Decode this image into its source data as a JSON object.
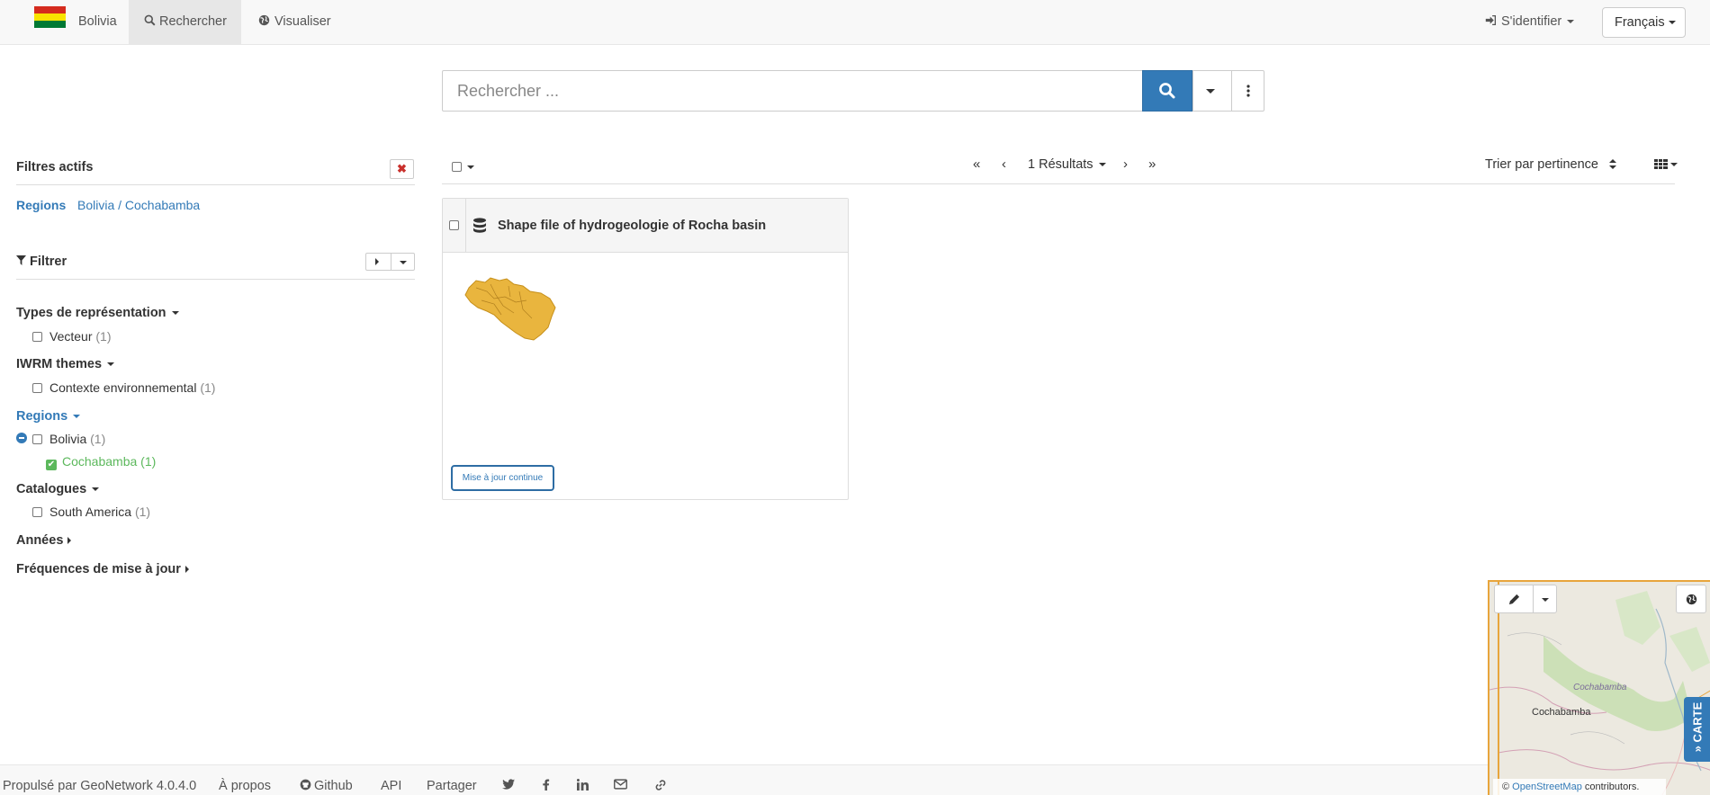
{
  "navbar": {
    "brand": "Bolivia",
    "search_tab": "Rechercher",
    "visualize_tab": "Visualiser",
    "login": "S'identifier",
    "language": "Français",
    "flag_colors": [
      "#d52b1e",
      "#f9e300",
      "#007934"
    ]
  },
  "search": {
    "placeholder": "Rechercher ..."
  },
  "active_filters": {
    "title": "Filtres actifs",
    "filter_key": "Regions",
    "filter_value": "Bolivia / Cochabamba"
  },
  "filter_panel": {
    "title": "Filtrer"
  },
  "facets": {
    "types": {
      "title": "Types de représentation",
      "items": [
        {
          "label": "Vecteur",
          "count": "(1)"
        }
      ]
    },
    "iwrm": {
      "title": "IWRM themes",
      "items": [
        {
          "label": "Contexte environnemental",
          "count": "(1)"
        }
      ]
    },
    "regions": {
      "title": "Regions",
      "items": [
        {
          "label": "Bolivia",
          "count": "(1)"
        },
        {
          "label": "Cochabamba",
          "count": "(1)",
          "checked": true
        }
      ]
    },
    "catalogues": {
      "title": "Catalogues",
      "items": [
        {
          "label": "South America",
          "count": "(1)"
        }
      ]
    },
    "annees": {
      "title": "Années"
    },
    "frequences": {
      "title": "Fréquences de mise à jour"
    }
  },
  "results_toolbar": {
    "results": "1 Résultats",
    "sort": "Trier par pertinence"
  },
  "result": {
    "title": "Shape file of hydrogeologie of Rocha basin",
    "update_badge": "Mise à jour continue"
  },
  "map": {
    "carte_label": "CARTE",
    "city_label": "Cochabamba",
    "region_label": "Cochabamba",
    "attribution_prefix": "©",
    "attribution_link": "OpenStreetMap",
    "attribution_suffix": "contributors."
  },
  "footer": {
    "powered": "Propulsé par GeoNetwork 4.0.4.0",
    "about": "À propos",
    "github": "Github",
    "api": "API",
    "share": "Partager"
  },
  "colors": {
    "accent": "#337ab7",
    "success": "#5cb85c",
    "danger": "#c9302c",
    "map_highlight": "#e8a53c"
  }
}
